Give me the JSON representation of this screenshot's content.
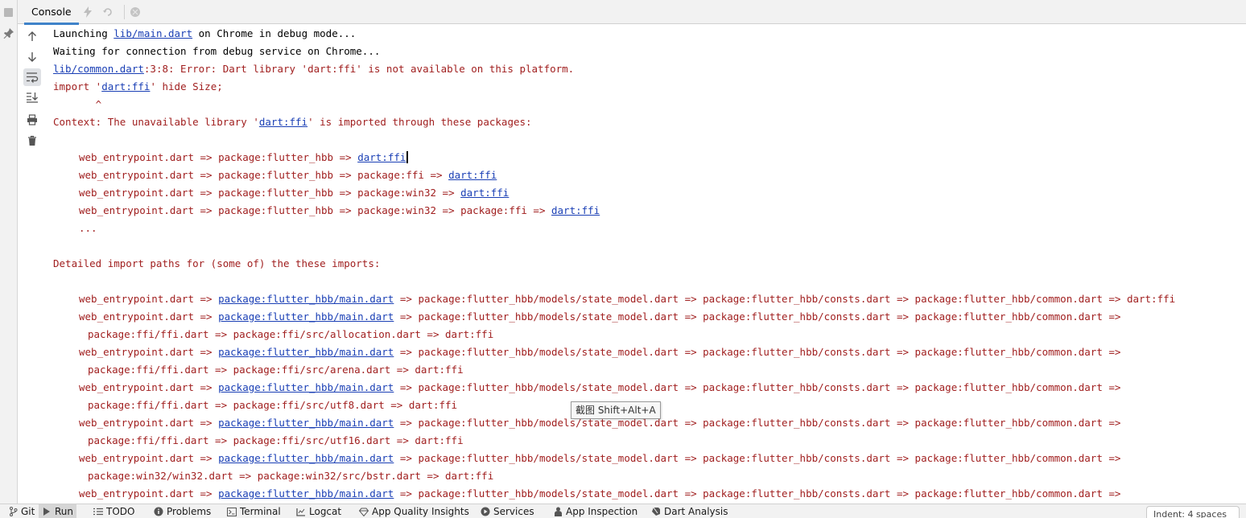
{
  "header": {
    "tab_label": "Console"
  },
  "console": {
    "lines": [
      {
        "cls": "norm",
        "segs": [
          {
            "t": "Launching "
          },
          {
            "t": "lib/main.dart",
            "link": true
          },
          {
            "t": " on Chrome in debug mode..."
          }
        ]
      },
      {
        "cls": "norm",
        "segs": [
          {
            "t": "Waiting for connection from debug service on Chrome..."
          }
        ]
      },
      {
        "cls": "err",
        "segs": [
          {
            "t": "lib/common.dart",
            "link": true
          },
          {
            "t": ":3:8: Error: Dart library 'dart:ffi' is not available on this platform."
          }
        ]
      },
      {
        "cls": "err",
        "segs": [
          {
            "t": "import '"
          },
          {
            "t": "dart:ffi",
            "link": true
          },
          {
            "t": "' hide Size;"
          }
        ]
      },
      {
        "cls": "err",
        "segs": [
          {
            "t": "       ^"
          }
        ]
      },
      {
        "cls": "err",
        "segs": [
          {
            "t": "Context: The unavailable library '"
          },
          {
            "t": "dart:ffi",
            "link": true
          },
          {
            "t": "' is imported through these packages:"
          }
        ]
      },
      {
        "cls": "err",
        "segs": []
      },
      {
        "cls": "err",
        "indent": 1,
        "caret": true,
        "segs": [
          {
            "t": "web_entrypoint.dart => package:flutter_hbb => "
          },
          {
            "t": "dart:ffi",
            "link": true
          }
        ]
      },
      {
        "cls": "err",
        "indent": 1,
        "segs": [
          {
            "t": "web_entrypoint.dart => package:flutter_hbb => package:ffi => "
          },
          {
            "t": "dart:ffi",
            "link": true
          }
        ]
      },
      {
        "cls": "err",
        "indent": 1,
        "segs": [
          {
            "t": "web_entrypoint.dart => package:flutter_hbb => package:win32 => "
          },
          {
            "t": "dart:ffi",
            "link": true
          }
        ]
      },
      {
        "cls": "err",
        "indent": 1,
        "segs": [
          {
            "t": "web_entrypoint.dart => package:flutter_hbb => package:win32 => package:ffi => "
          },
          {
            "t": "dart:ffi",
            "link": true
          }
        ]
      },
      {
        "cls": "err",
        "indent": 1,
        "segs": [
          {
            "t": "..."
          }
        ]
      },
      {
        "cls": "err",
        "segs": []
      },
      {
        "cls": "err",
        "segs": [
          {
            "t": "Detailed import paths for (some of) the these imports:"
          }
        ]
      },
      {
        "cls": "err",
        "segs": []
      },
      {
        "cls": "err",
        "indent": 1,
        "segs": [
          {
            "t": "web_entrypoint.dart => "
          },
          {
            "t": "package:flutter_hbb/main.dart",
            "link": true
          },
          {
            "t": " => package:flutter_hbb/models/state_model.dart => package:flutter_hbb/consts.dart => package:flutter_hbb/common.dart => dart:ffi"
          }
        ]
      },
      {
        "cls": "err",
        "indent": 1,
        "segs": [
          {
            "t": "web_entrypoint.dart => "
          },
          {
            "t": "package:flutter_hbb/main.dart",
            "link": true
          },
          {
            "t": " => package:flutter_hbb/models/state_model.dart => package:flutter_hbb/consts.dart => package:flutter_hbb/common.dart =>"
          }
        ]
      },
      {
        "cls": "err",
        "indent": 2,
        "segs": [
          {
            "t": "package:ffi/ffi.dart => package:ffi/src/allocation.dart => dart:ffi"
          }
        ]
      },
      {
        "cls": "err",
        "indent": 1,
        "segs": [
          {
            "t": "web_entrypoint.dart => "
          },
          {
            "t": "package:flutter_hbb/main.dart",
            "link": true
          },
          {
            "t": " => package:flutter_hbb/models/state_model.dart => package:flutter_hbb/consts.dart => package:flutter_hbb/common.dart =>"
          }
        ]
      },
      {
        "cls": "err",
        "indent": 2,
        "segs": [
          {
            "t": "package:ffi/ffi.dart => package:ffi/src/arena.dart => dart:ffi"
          }
        ]
      },
      {
        "cls": "err",
        "indent": 1,
        "segs": [
          {
            "t": "web_entrypoint.dart => "
          },
          {
            "t": "package:flutter_hbb/main.dart",
            "link": true
          },
          {
            "t": " => package:flutter_hbb/models/state_model.dart => package:flutter_hbb/consts.dart => package:flutter_hbb/common.dart =>"
          }
        ]
      },
      {
        "cls": "err",
        "indent": 2,
        "segs": [
          {
            "t": "package:ffi/ffi.dart => package:ffi/src/utf8.dart => dart:ffi"
          }
        ]
      },
      {
        "cls": "err",
        "indent": 1,
        "segs": [
          {
            "t": "web_entrypoint.dart => "
          },
          {
            "t": "package:flutter_hbb/main.dart",
            "link": true
          },
          {
            "t": " => package:flutter_hbb/models/state_model.dart => package:flutter_hbb/consts.dart => package:flutter_hbb/common.dart =>"
          }
        ]
      },
      {
        "cls": "err",
        "indent": 2,
        "segs": [
          {
            "t": "package:ffi/ffi.dart => package:ffi/src/utf16.dart => dart:ffi"
          }
        ]
      },
      {
        "cls": "err",
        "indent": 1,
        "segs": [
          {
            "t": "web_entrypoint.dart => "
          },
          {
            "t": "package:flutter_hbb/main.dart",
            "link": true
          },
          {
            "t": " => package:flutter_hbb/models/state_model.dart => package:flutter_hbb/consts.dart => package:flutter_hbb/common.dart =>"
          }
        ]
      },
      {
        "cls": "err",
        "indent": 2,
        "segs": [
          {
            "t": "package:win32/win32.dart => package:win32/src/bstr.dart => dart:ffi"
          }
        ]
      },
      {
        "cls": "err",
        "indent": 1,
        "segs": [
          {
            "t": "web_entrypoint.dart => "
          },
          {
            "t": "package:flutter_hbb/main.dart",
            "link": true
          },
          {
            "t": " => package:flutter_hbb/models/state_model.dart => package:flutter_hbb/consts.dart => package:flutter_hbb/common.dart =>"
          }
        ]
      }
    ]
  },
  "tooltip": {
    "text": "截图 Shift+Alt+A"
  },
  "bottom_bar": {
    "items": [
      {
        "name": "git",
        "label": "Git",
        "icon": "git-branch-icon",
        "active": false
      },
      {
        "name": "run",
        "label": "Run",
        "icon": "play-icon",
        "active": true
      },
      {
        "name": "todo",
        "label": "TODO",
        "icon": "list-icon",
        "active": false
      },
      {
        "name": "problems",
        "label": "Problems",
        "icon": "info-circle-icon",
        "active": false
      },
      {
        "name": "terminal",
        "label": "Terminal",
        "icon": "terminal-icon",
        "active": false
      },
      {
        "name": "logcat",
        "label": "Logcat",
        "icon": "logcat-icon",
        "active": false
      },
      {
        "name": "app-quality-insights",
        "label": "App Quality Insights",
        "icon": "diamond-icon",
        "active": false
      },
      {
        "name": "services",
        "label": "Services",
        "icon": "services-icon",
        "active": false
      },
      {
        "name": "app-inspection",
        "label": "App Inspection",
        "icon": "inspection-icon",
        "active": false
      },
      {
        "name": "dart-analysis",
        "label": "Dart Analysis",
        "icon": "dart-icon",
        "active": false
      }
    ],
    "indent_label": "Indent: 4 spaces"
  }
}
